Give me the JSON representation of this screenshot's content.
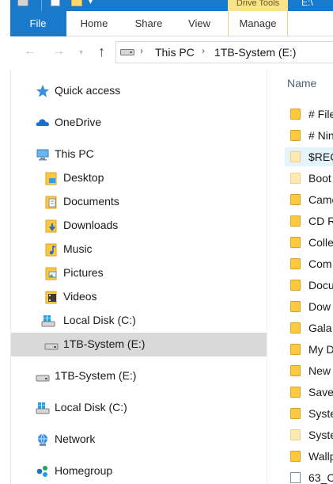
{
  "titlebar": {
    "contextual_tab_label": "Drive Tools",
    "right_text": "E:\\"
  },
  "ribbon": {
    "tabs": [
      "File",
      "Home",
      "Share",
      "View",
      "Manage"
    ]
  },
  "address_bar": {
    "crumbs": [
      "This PC",
      "1TB-System (E:)"
    ]
  },
  "nav_pane": {
    "items": [
      {
        "label": "Quick access",
        "icon": "quick-access-star-icon"
      },
      {
        "label": "OneDrive",
        "icon": "onedrive-cloud-icon"
      },
      {
        "label": "This PC",
        "icon": "this-pc-icon"
      },
      {
        "label": "Desktop",
        "icon": "desktop-folder-icon"
      },
      {
        "label": "Documents",
        "icon": "documents-folder-icon"
      },
      {
        "label": "Downloads",
        "icon": "downloads-folder-icon"
      },
      {
        "label": "Music",
        "icon": "music-folder-icon"
      },
      {
        "label": "Pictures",
        "icon": "pictures-folder-icon"
      },
      {
        "label": "Videos",
        "icon": "videos-folder-icon"
      },
      {
        "label": "Local Disk (C:)",
        "icon": "windows-drive-icon"
      },
      {
        "label": "1TB-System (E:)",
        "icon": "drive-icon",
        "selected": true
      },
      {
        "label": "1TB-System (E:)",
        "icon": "drive-icon"
      },
      {
        "label": "Local Disk (C:)",
        "icon": "windows-drive-icon"
      },
      {
        "label": "Network",
        "icon": "network-icon"
      },
      {
        "label": "Homegroup",
        "icon": "homegroup-icon"
      }
    ]
  },
  "file_list": {
    "column_header": "Name",
    "rows": [
      {
        "name": "# File",
        "icon": "folder-icon"
      },
      {
        "name": "# Nin",
        "icon": "folder-icon"
      },
      {
        "name": "$REC",
        "icon": "folder-faded-icon",
        "highlighted": true
      },
      {
        "name": "Boot",
        "icon": "folder-faded-icon"
      },
      {
        "name": "Came",
        "icon": "folder-icon"
      },
      {
        "name": "CD R",
        "icon": "folder-icon"
      },
      {
        "name": "Colle",
        "icon": "folder-icon"
      },
      {
        "name": "Com",
        "icon": "folder-icon"
      },
      {
        "name": "Docu",
        "icon": "folder-icon"
      },
      {
        "name": "Dow",
        "icon": "folder-icon"
      },
      {
        "name": "Gala",
        "icon": "folder-icon"
      },
      {
        "name": "My D",
        "icon": "folder-icon"
      },
      {
        "name": "New",
        "icon": "folder-icon"
      },
      {
        "name": "Save",
        "icon": "folder-icon"
      },
      {
        "name": "Syste",
        "icon": "folder-icon"
      },
      {
        "name": "Syste",
        "icon": "folder-faded-icon"
      },
      {
        "name": "Wallp",
        "icon": "folder-icon"
      },
      {
        "name": "63_C",
        "icon": "file-icon"
      }
    ]
  },
  "colors": {
    "file_tab": "#1979ca",
    "selected_row": "#d9d9d9",
    "folder": "#ffc83d",
    "header_text": "#4c607a"
  }
}
